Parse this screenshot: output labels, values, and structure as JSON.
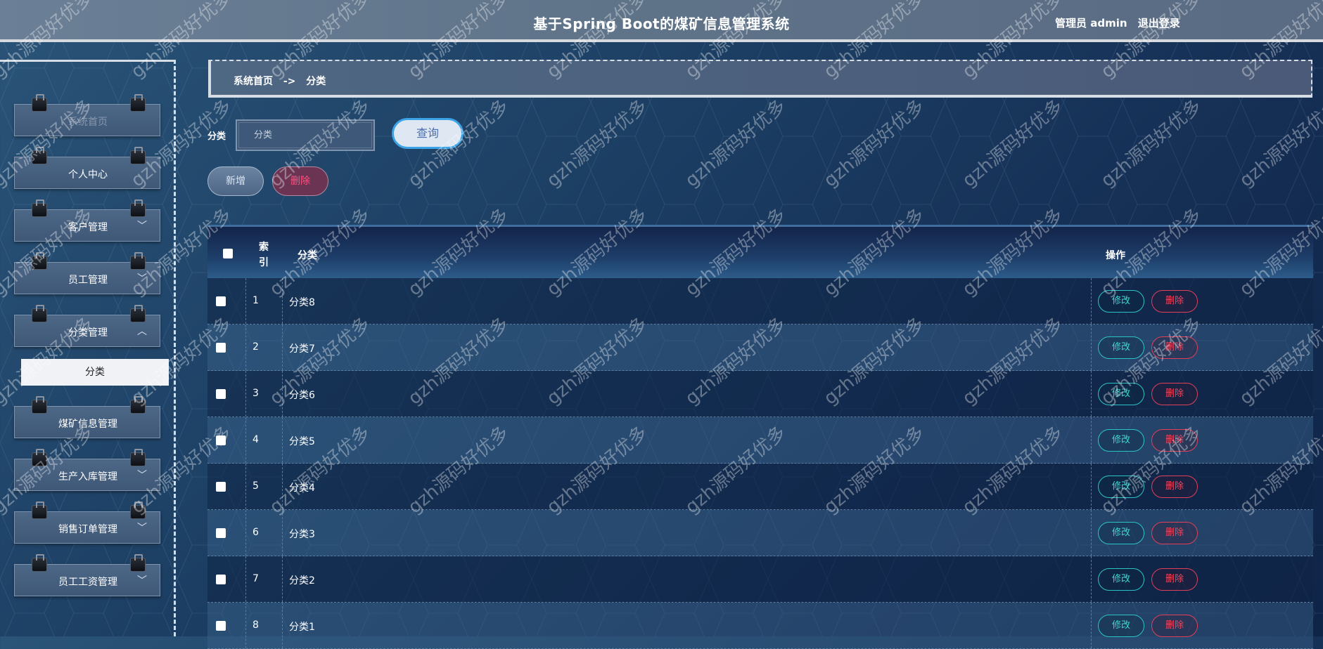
{
  "header": {
    "title": "基于Spring Boot的煤矿信息管理系统",
    "user_label": "管理员 admin",
    "logout_label": "退出登录"
  },
  "sidebar": {
    "items": [
      {
        "label": "系统首页",
        "disabled": true,
        "chevron": ""
      },
      {
        "label": "个人中心",
        "chevron": ""
      },
      {
        "label": "客户管理",
        "chevron": "﹀"
      },
      {
        "label": "员工管理",
        "chevron": "﹀"
      },
      {
        "label": "分类管理",
        "chevron": "︿"
      },
      {
        "label": "煤矿信息管理",
        "chevron": ""
      },
      {
        "label": "生产入库管理",
        "chevron": "﹀"
      },
      {
        "label": "销售订单管理",
        "chevron": "﹀"
      },
      {
        "label": "员工工资管理",
        "chevron": "﹀"
      }
    ],
    "active_sub": "分类"
  },
  "breadcrumb": {
    "home": "系统首页",
    "separator": "->",
    "current": "分类"
  },
  "search": {
    "label": "分类",
    "placeholder": "分类",
    "button": "查询"
  },
  "actions": {
    "add": "新增",
    "delete": "删除"
  },
  "table": {
    "headers": {
      "index": "索引",
      "category": "分类",
      "ops": "操作"
    },
    "edit_label": "修改",
    "delete_label": "删除",
    "rows": [
      {
        "index": "1",
        "category": "分类8"
      },
      {
        "index": "2",
        "category": "分类7"
      },
      {
        "index": "3",
        "category": "分类6"
      },
      {
        "index": "4",
        "category": "分类5"
      },
      {
        "index": "5",
        "category": "分类4"
      },
      {
        "index": "6",
        "category": "分类3"
      },
      {
        "index": "7",
        "category": "分类2"
      },
      {
        "index": "8",
        "category": "分类1"
      }
    ]
  },
  "watermark": "gzh源码好优多"
}
